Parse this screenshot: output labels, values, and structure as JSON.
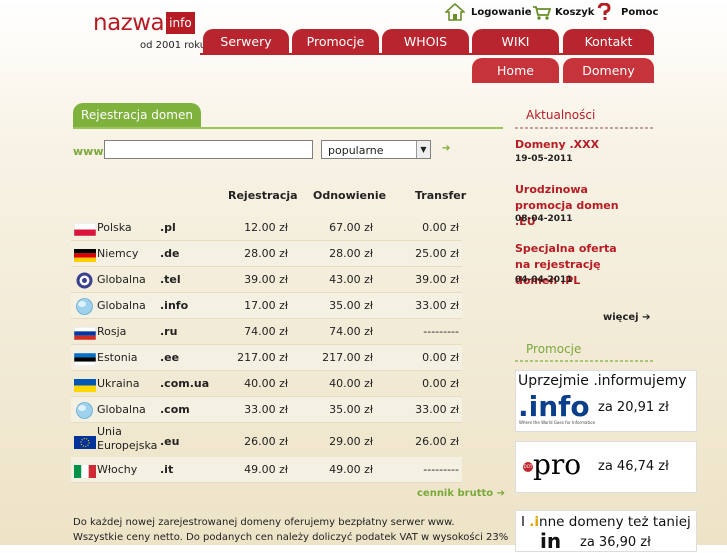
{
  "logo": {
    "word": "nazwa",
    "box": "info",
    "since": "od 2001 roku"
  },
  "top_links": {
    "login": "Logowanie",
    "cart": "Koszyk",
    "help": "Pomoc"
  },
  "nav_tabs_row1": [
    "Serwery",
    "Promocje",
    "WHOIS",
    "WIKI",
    "Kontakt"
  ],
  "nav_tabs_row2": [
    "Home",
    "Domeny"
  ],
  "section_tab": "Rejestracja domen",
  "search": {
    "label": "www.",
    "value": "",
    "select_value": "popularne",
    "arrow": "➔"
  },
  "table": {
    "headers": {
      "reg": "Rejestracja",
      "renew": "Odnowienie",
      "transfer": "Transfer"
    },
    "rows": [
      {
        "country": "Polska",
        "tld": ".pl",
        "reg": "12.00 zł",
        "renew": "67.00 zł",
        "transfer": "0.00 zł",
        "icon": "flag-pl"
      },
      {
        "country": "Niemcy",
        "tld": ".de",
        "reg": "28.00 zł",
        "renew": "28.00 zł",
        "transfer": "25.00 zł",
        "icon": "flag-de"
      },
      {
        "country": "Globalna",
        "tld": ".tel",
        "reg": "39.00 zł",
        "renew": "43.00 zł",
        "transfer": "39.00 zł",
        "icon": "tel-icon"
      },
      {
        "country": "Globalna",
        "tld": ".info",
        "reg": "17.00 zł",
        "renew": "35.00 zł",
        "transfer": "33.00 zł",
        "icon": "globe-icon"
      },
      {
        "country": "Rosja",
        "tld": ".ru",
        "reg": "74.00 zł",
        "renew": "74.00 zł",
        "transfer": "---------",
        "icon": "flag-ru"
      },
      {
        "country": "Estonia",
        "tld": ".ee",
        "reg": "217.00 zł",
        "renew": "217.00 zł",
        "transfer": "0.00 zł",
        "icon": "flag-ee"
      },
      {
        "country": "Ukraina",
        "tld": ".com.ua",
        "reg": "40.00 zł",
        "renew": "40.00 zł",
        "transfer": "0.00 zł",
        "icon": "flag-ua"
      },
      {
        "country": "Globalna",
        "tld": ".com",
        "reg": "33.00 zł",
        "renew": "35.00 zł",
        "transfer": "33.00 zł",
        "icon": "globe-icon"
      },
      {
        "country": "Unia Europejska",
        "tld": ".eu",
        "reg": "26.00 zł",
        "renew": "29.00 zł",
        "transfer": "26.00 zł",
        "icon": "flag-eu"
      },
      {
        "country": "Włochy",
        "tld": ".it",
        "reg": "49.00 zł",
        "renew": "49.00 zł",
        "transfer": "---------",
        "icon": "flag-it"
      }
    ],
    "price_list_link": "cennik brutto ➔"
  },
  "notes": {
    "line1": "Do każdej nowej zarejestrowanej domeny oferujemy bezpłatny serwer www.",
    "line2": "Wszystkie ceny netto. Do podanych cen należy doliczyć podatek VAT w wysokości 23%"
  },
  "news": {
    "title": "Aktualności",
    "items": [
      {
        "title": "Domeny .XXX",
        "date": "19-05-2011"
      },
      {
        "title": "Urodzinowa promocja domen .EU",
        "date": "08-04-2011"
      },
      {
        "title": "Specjalna oferta na rejestrację domen .PL",
        "date": "04-04-2011"
      }
    ],
    "more": "więcej ➔"
  },
  "promo": {
    "title": "Promocje",
    "banner1": {
      "headline": "Uprzejmie .informujemy",
      "logo": ".info",
      "tagline": "Where the World Goes for Information",
      "price": "za 20,91 zł"
    },
    "banner2": {
      "logo": "pro",
      "badge": "DOT",
      "price": "za 46,74 zł"
    },
    "banner3": {
      "headline_pre": "I ",
      "headline_mark": ".i",
      "headline_post": "nne domeny też taniej",
      "logo": "in",
      "price": "za 36,90 zł"
    }
  },
  "colors": {
    "brand_red": "#b71c25",
    "accent_green": "#7aa93a"
  }
}
